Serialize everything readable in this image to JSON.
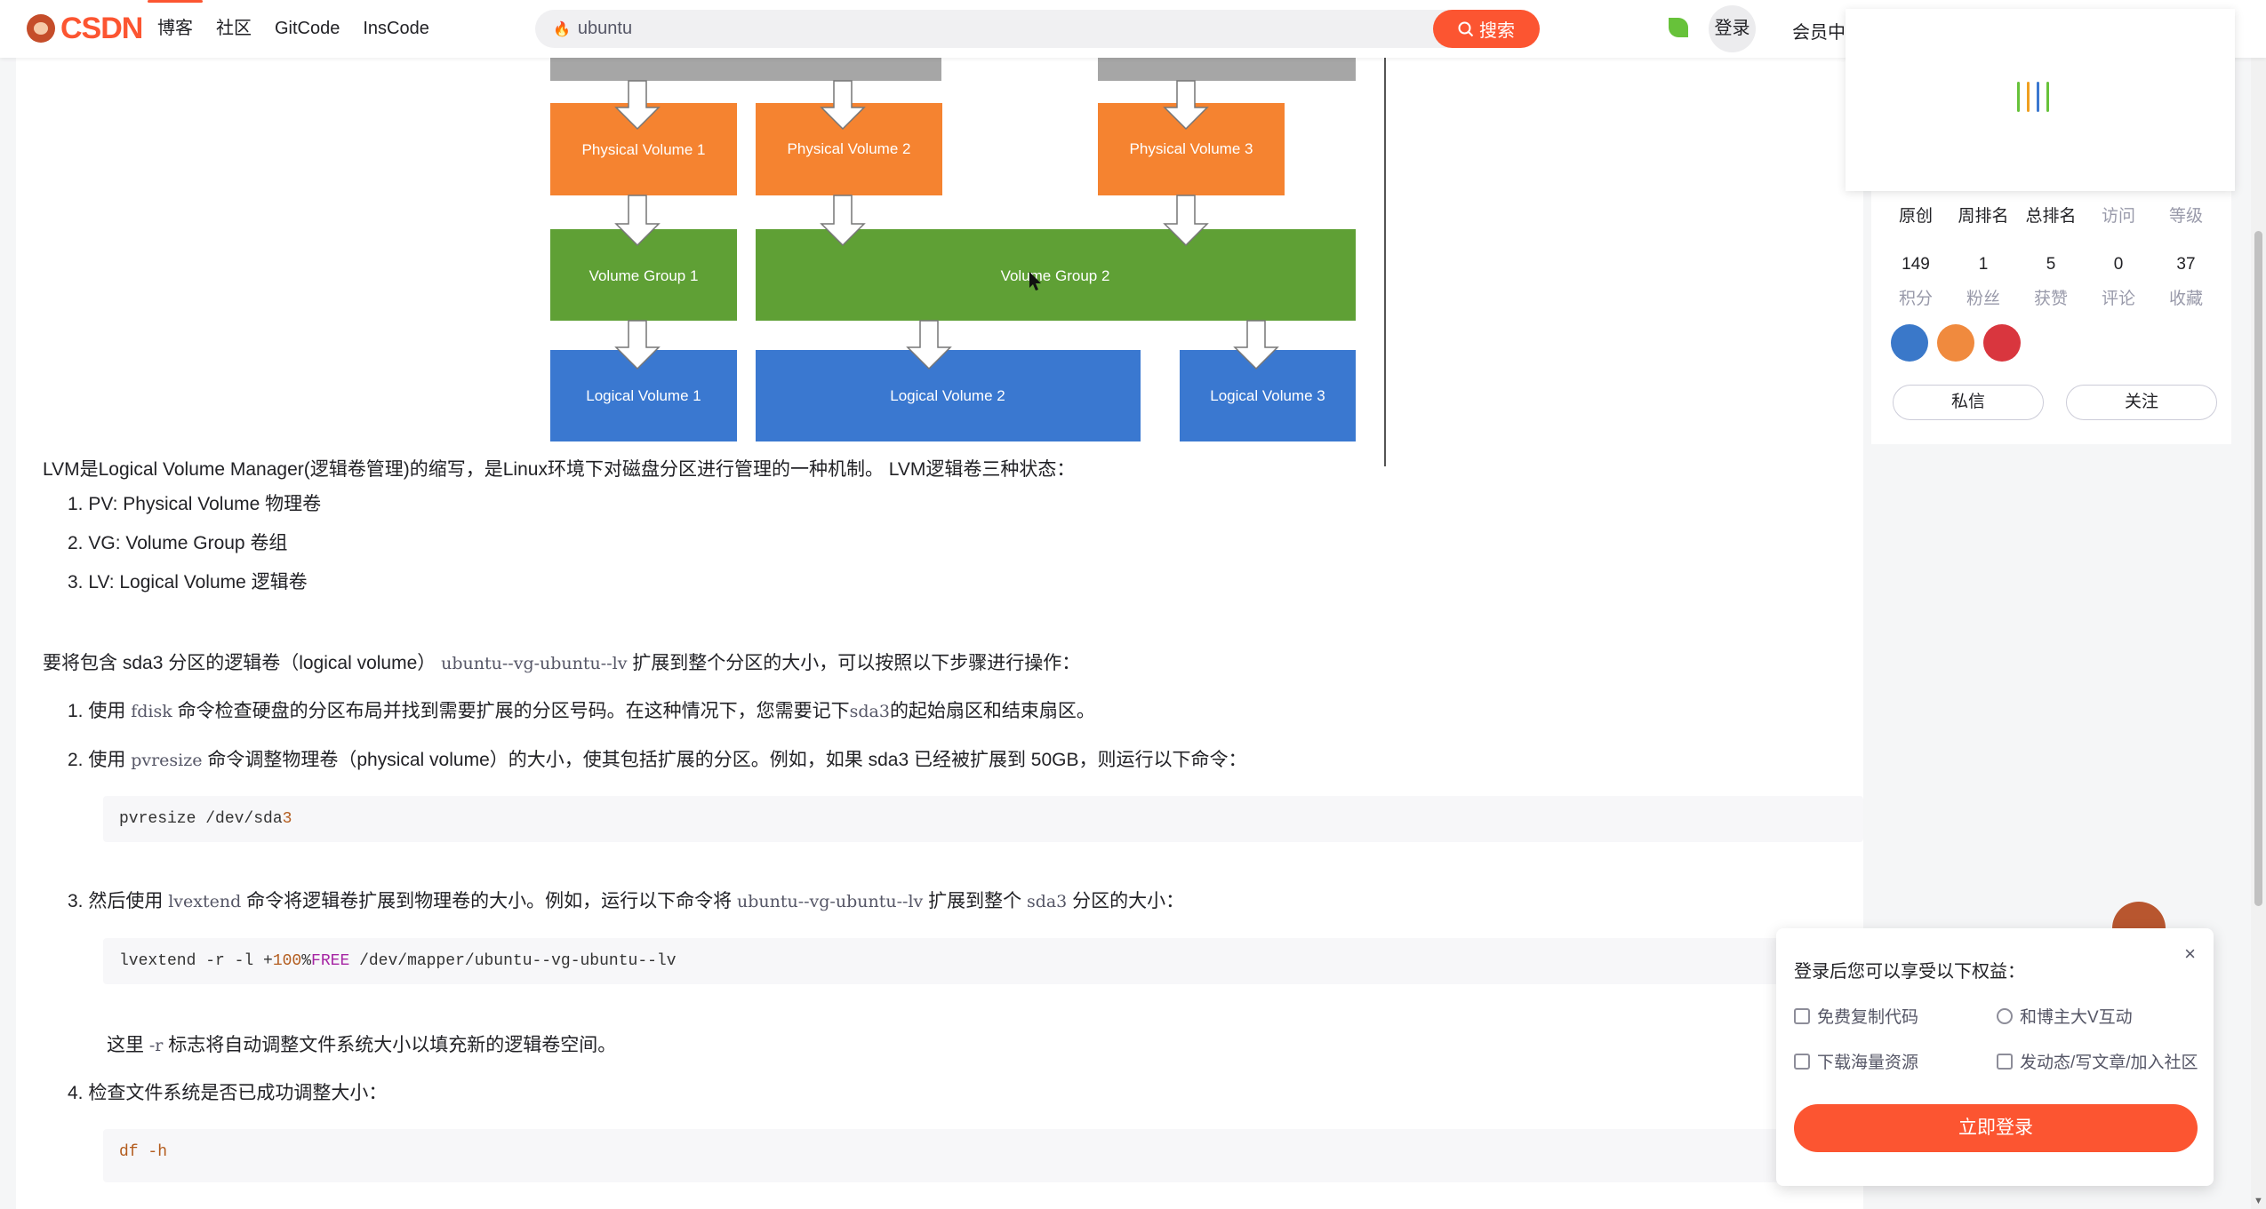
{
  "nav": {
    "logo_text": "CSDN",
    "links": [
      "博客",
      "社区",
      "GitCode",
      "InsCode"
    ],
    "search_value": "ubuntu",
    "search_button": "搜索",
    "login": "登录",
    "vip": "会员中心"
  },
  "diagram": {
    "physical_volumes": [
      "Physical Volume 1",
      "Physical Volume 2",
      "Physical Volume 3"
    ],
    "volume_groups": [
      "Volume Group 1",
      "Volume Group 2"
    ],
    "logical_volumes": [
      "Logical Volume 1",
      "Logical Volume 2",
      "Logical Volume 3"
    ],
    "colors": {
      "pv": "#f58330",
      "vg": "#5fa035",
      "lv": "#3a78d0",
      "disk": "#a6a6a6"
    }
  },
  "article": {
    "intro": "LVM是Logical Volume Manager(逻辑卷管理)的缩写，是Linux环境下对磁盘分区进行管理的一种机制。 LVM逻辑卷三种状态：",
    "states": [
      "1. PV: Physical Volume 物理卷",
      "2. VG: Volume Group 卷组",
      "3. LV: Logical Volume 逻辑卷"
    ],
    "task_prefix": "要将包含 sda3 分区的逻辑卷（logical volume）",
    "task_code": "ubuntu--vg-ubuntu--lv",
    "task_suffix": "扩展到整个分区的大小，可以按照以下步骤进行操作：",
    "step1_prefix": "1. 使用",
    "step1_code": "fdisk",
    "step1_mid": "命令检查硬盘的分区布局并找到需要扩展的分区号码。在这种情况下，您需要记下",
    "step1_code2": "sda3",
    "step1_suffix": "的起始扇区和结束扇区。",
    "step2_prefix": "2. 使用",
    "step2_code": "pvresize",
    "step2_suffix": "命令调整物理卷（physical volume）的大小，使其包括扩展的分区。例如，如果 sda3 已经被扩展到 50GB，则运行以下命令：",
    "code1_a": "pvresize /dev/sda",
    "code1_b": "3",
    "step3_prefix": "3. 然后使用",
    "step3_code": "lvextend",
    "step3_mid": "命令将逻辑卷扩展到物理卷的大小。例如，运行以下命令将",
    "step3_code2": "ubuntu--vg-ubuntu--lv",
    "step3_mid2": "扩展到整个",
    "step3_code3": "sda3",
    "step3_suffix": "分区的大小：",
    "code2_a": "lvextend -r -l +",
    "code2_b": "100",
    "code2_c": "%",
    "code2_d": "FREE",
    "code2_e": " /dev/mapper/ubuntu--vg-ubuntu--lv",
    "note_prefix": "这里",
    "note_code": "-r",
    "note_suffix": "标志将自动调整文件系统大小以填充新的逻辑卷空间。",
    "step4": "4. 检查文件系统是否已成功调整大小：",
    "code3": "df -h"
  },
  "profile": {
    "top_stats": [
      "原创",
      "周排名",
      "总排名",
      "访问",
      "等级"
    ],
    "stats": [
      {
        "value": "149",
        "label": "积分"
      },
      {
        "value": "1",
        "label": "粉丝"
      },
      {
        "value": "5",
        "label": "获赞"
      },
      {
        "value": "0",
        "label": "评论"
      },
      {
        "value": "37",
        "label": "收藏"
      }
    ],
    "message_button": "私信",
    "follow_button": "关注"
  },
  "popup": {
    "title": "登录后您可以享受以下权益：",
    "close": "×",
    "benefits": [
      "免费复制代码",
      "和博主大V互动",
      "下载海量资源",
      "发动态/写文章/加入社区"
    ],
    "button": "立即登录"
  }
}
